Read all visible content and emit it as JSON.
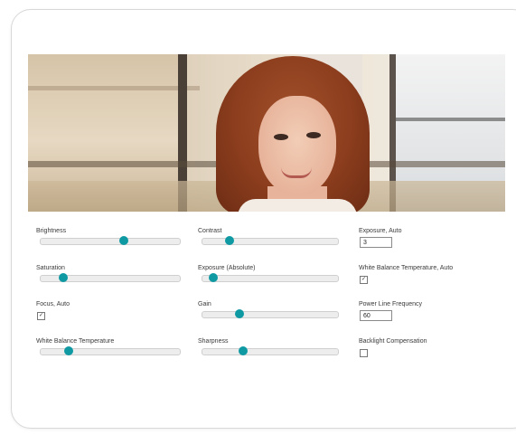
{
  "controls": {
    "col1": [
      {
        "label": "Brightness",
        "type": "slider",
        "value_fraction": 0.6
      },
      {
        "label": "Saturation",
        "type": "slider",
        "value_fraction": 0.16
      },
      {
        "label": "Focus, Auto",
        "type": "checkbox",
        "checked": true
      },
      {
        "label": "White Balance Temperature",
        "type": "slider",
        "value_fraction": 0.2
      }
    ],
    "col2": [
      {
        "label": "Contrast",
        "type": "slider",
        "value_fraction": 0.2
      },
      {
        "label": "Exposure (Absolute)",
        "type": "slider",
        "value_fraction": 0.08
      },
      {
        "label": "Gain",
        "type": "slider",
        "value_fraction": 0.27
      },
      {
        "label": "Sharpness",
        "type": "slider",
        "value_fraction": 0.3
      }
    ],
    "col3": [
      {
        "label": "Exposure, Auto",
        "type": "number",
        "value": "3"
      },
      {
        "label": "White Balance Temperature, Auto",
        "type": "checkbox",
        "checked": true
      },
      {
        "label": "Power Line Frequency",
        "type": "number",
        "value": "60"
      },
      {
        "label": "Backlight Compensation",
        "type": "checkbox",
        "checked": false
      }
    ]
  },
  "colors": {
    "slider_thumb": "#0f9aa3",
    "slider_track": "#ededed",
    "card_border": "#d8d8d8"
  },
  "icons": {
    "checkbox_checked": "check-mark-icon"
  }
}
